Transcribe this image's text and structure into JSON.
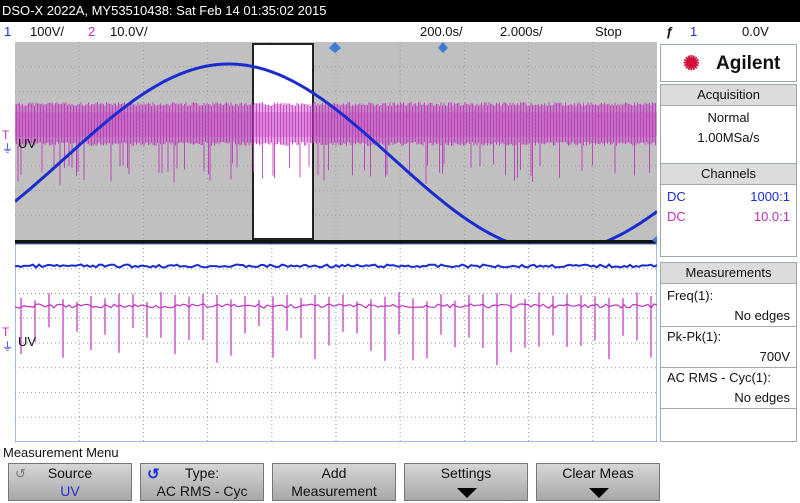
{
  "title_bar": "DSO-X 2022A, MY53510438: Sat Feb 14 01:35:02 2015",
  "status": {
    "ch1_num": "1",
    "ch1_scale": "100V/",
    "ch2_num": "2",
    "ch2_scale": "10.0V/",
    "timebase_delay": "200.0s/",
    "timebase_scale": "2.000s/",
    "run_state": "Stop",
    "trigger_icon": "ƒ",
    "trigger_channel": "1",
    "trigger_level": "0.0V"
  },
  "channel_label": "UV",
  "side_panel": {
    "brand": "Agilent",
    "acquisition": {
      "header": "Acquisition",
      "mode": "Normal",
      "rate": "1.00MSa/s"
    },
    "channels": {
      "header": "Channels",
      "rows": [
        {
          "coupling": "DC",
          "probe": "1000:1",
          "color": "#1a2ccf"
        },
        {
          "coupling": "DC",
          "probe": "10.0:1",
          "color": "#c030c0"
        }
      ]
    },
    "measurements": {
      "header": "Measurements",
      "items": [
        {
          "name": "Freq(1):",
          "value": "No edges"
        },
        {
          "name": "Pk-Pk(1):",
          "value": "700V"
        },
        {
          "name": "AC RMS - Cyc(1):",
          "value": "No edges"
        }
      ]
    }
  },
  "menu_title": "Measurement Menu",
  "softkeys": [
    {
      "line1": "Source",
      "line2": "UV"
    },
    {
      "line1": "Type:",
      "line2": "AC RMS - Cyc"
    },
    {
      "line1": "Add",
      "line2": "Measurement"
    },
    {
      "line1": "Settings",
      "line2": ""
    },
    {
      "line1": "Clear Meas",
      "line2": ""
    }
  ],
  "colors": {
    "ch1": "#1a2ccf",
    "ch2": "#c030c0",
    "grid_bg": "#c0c0c0"
  }
}
